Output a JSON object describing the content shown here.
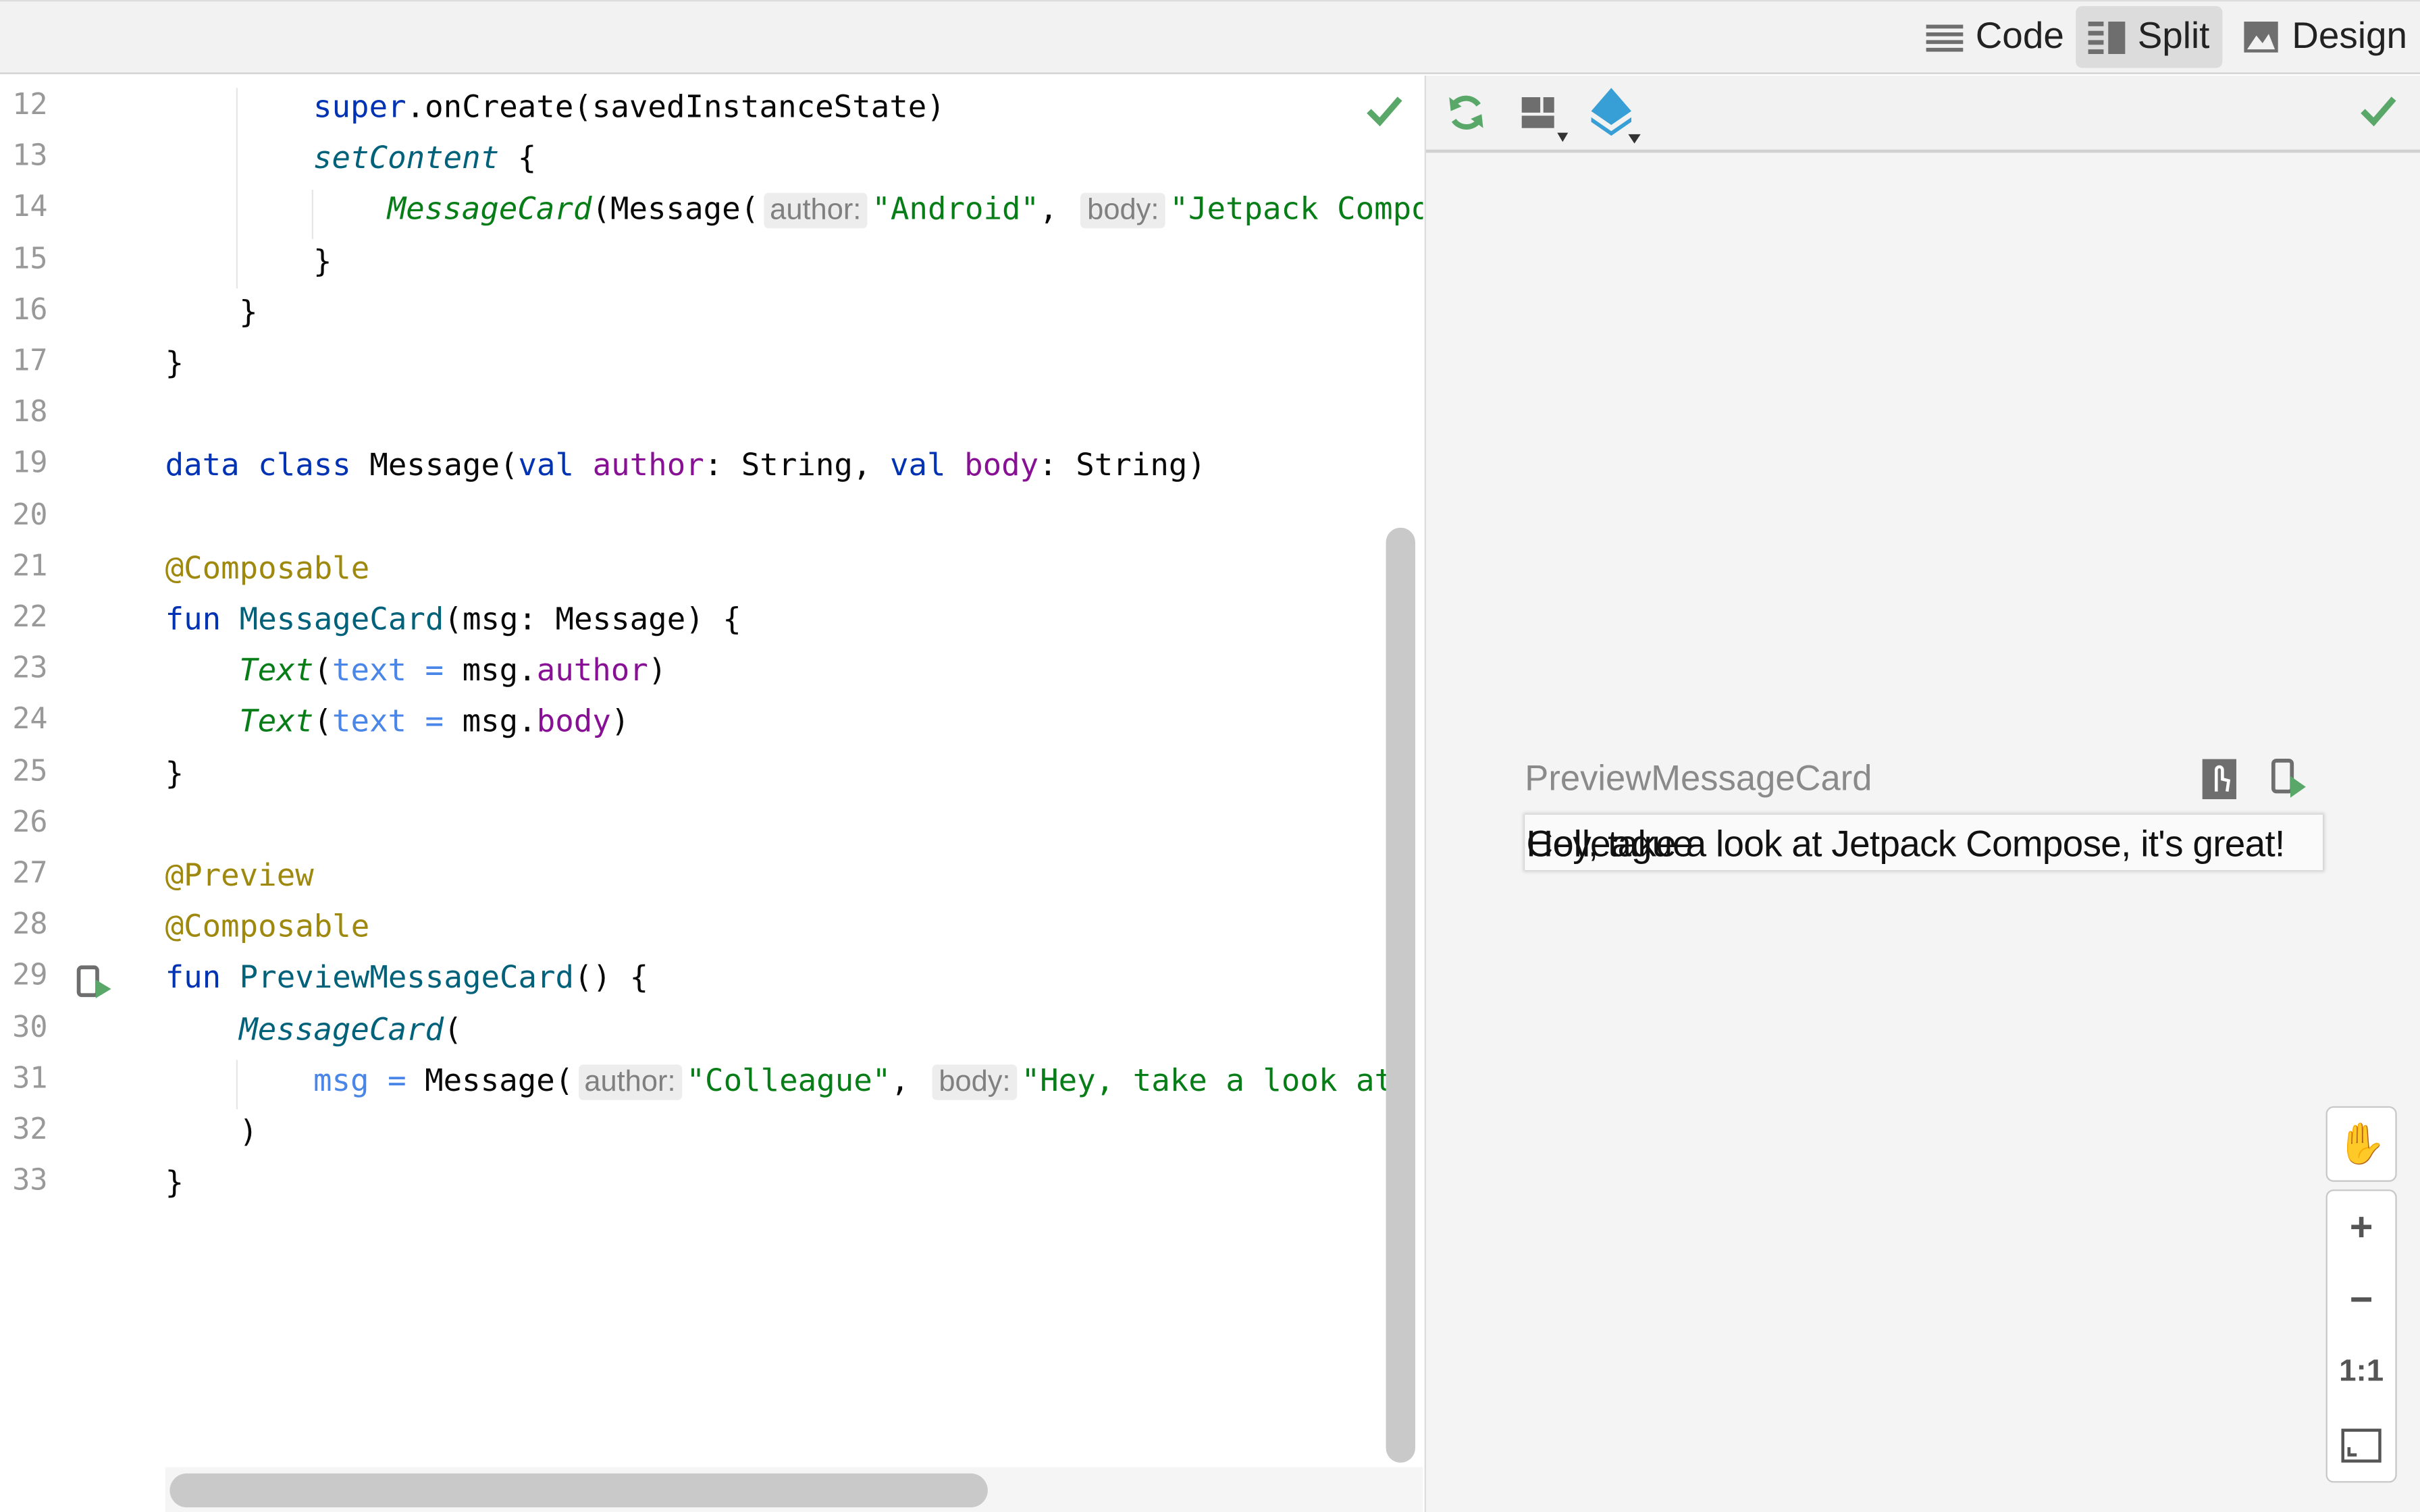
{
  "header": {
    "modes": [
      {
        "label": "Code",
        "icon": "lines-icon",
        "selected": false
      },
      {
        "label": "Split",
        "icon": "split-icon",
        "selected": true
      },
      {
        "label": "Design",
        "icon": "image-icon",
        "selected": false
      }
    ]
  },
  "editor": {
    "lines": [
      {
        "n": "12",
        "indent": 8,
        "tokens": [
          {
            "t": "super",
            "c": "kw"
          },
          {
            "t": ".onCreate(savedInstanceState)",
            "c": ""
          }
        ]
      },
      {
        "n": "13",
        "indent": 8,
        "tokens": [
          {
            "t": "setContent",
            "c": "ifn"
          },
          {
            "t": " {",
            "c": ""
          }
        ]
      },
      {
        "n": "14",
        "indent": 12,
        "tokens": [
          {
            "t": "MessageCard",
            "c": "igr"
          },
          {
            "t": "(Message(",
            "c": ""
          },
          {
            "t": "author:",
            "c": "hint"
          },
          {
            "t": "\"Android\"",
            "c": "str"
          },
          {
            "t": ", ",
            "c": ""
          },
          {
            "t": "body:",
            "c": "hint"
          },
          {
            "t": "\"Jetpack Compose\"",
            "c": "str"
          }
        ]
      },
      {
        "n": "15",
        "indent": 8,
        "tokens": [
          {
            "t": "}",
            "c": ""
          }
        ]
      },
      {
        "n": "16",
        "indent": 4,
        "tokens": [
          {
            "t": "}",
            "c": ""
          }
        ]
      },
      {
        "n": "17",
        "indent": 0,
        "tokens": [
          {
            "t": "}",
            "c": ""
          }
        ]
      },
      {
        "n": "18",
        "indent": 0,
        "tokens": []
      },
      {
        "n": "19",
        "indent": 0,
        "tokens": [
          {
            "t": "data class ",
            "c": "kw"
          },
          {
            "t": "Message(",
            "c": ""
          },
          {
            "t": "val ",
            "c": "kw"
          },
          {
            "t": "author",
            "c": "prop"
          },
          {
            "t": ": String, ",
            "c": ""
          },
          {
            "t": "val ",
            "c": "kw"
          },
          {
            "t": "body",
            "c": "prop"
          },
          {
            "t": ": String)",
            "c": ""
          }
        ]
      },
      {
        "n": "20",
        "indent": 0,
        "tokens": []
      },
      {
        "n": "21",
        "indent": 0,
        "tokens": [
          {
            "t": "@Composable",
            "c": "ann"
          }
        ]
      },
      {
        "n": "22",
        "indent": 0,
        "tokens": [
          {
            "t": "fun ",
            "c": "kw"
          },
          {
            "t": "MessageCard",
            "c": "fn"
          },
          {
            "t": "(msg: Message) {",
            "c": ""
          }
        ]
      },
      {
        "n": "23",
        "indent": 4,
        "tokens": [
          {
            "t": "Text",
            "c": "igr"
          },
          {
            "t": "(",
            "c": ""
          },
          {
            "t": "text = ",
            "c": "par"
          },
          {
            "t": "msg.",
            "c": ""
          },
          {
            "t": "author",
            "c": "prop"
          },
          {
            "t": ")",
            "c": ""
          }
        ]
      },
      {
        "n": "24",
        "indent": 4,
        "tokens": [
          {
            "t": "Text",
            "c": "igr"
          },
          {
            "t": "(",
            "c": ""
          },
          {
            "t": "text = ",
            "c": "par"
          },
          {
            "t": "msg.",
            "c": ""
          },
          {
            "t": "body",
            "c": "prop"
          },
          {
            "t": ")",
            "c": ""
          }
        ]
      },
      {
        "n": "25",
        "indent": 0,
        "tokens": [
          {
            "t": "}",
            "c": ""
          }
        ]
      },
      {
        "n": "26",
        "indent": 0,
        "tokens": []
      },
      {
        "n": "27",
        "indent": 0,
        "tokens": [
          {
            "t": "@Preview",
            "c": "ann"
          }
        ]
      },
      {
        "n": "28",
        "indent": 0,
        "tokens": [
          {
            "t": "@Composable",
            "c": "ann"
          }
        ]
      },
      {
        "n": "29",
        "indent": 0,
        "tokens": [
          {
            "t": "fun ",
            "c": "kw"
          },
          {
            "t": "PreviewMessageCard",
            "c": "fn"
          },
          {
            "t": "() {",
            "c": ""
          }
        ]
      },
      {
        "n": "30",
        "indent": 4,
        "tokens": [
          {
            "t": "MessageCard",
            "c": "ifn"
          },
          {
            "t": "(",
            "c": ""
          }
        ]
      },
      {
        "n": "31",
        "indent": 8,
        "tokens": [
          {
            "t": "msg = ",
            "c": "par"
          },
          {
            "t": "Message(",
            "c": ""
          },
          {
            "t": "author:",
            "c": "hint"
          },
          {
            "t": "\"Colleague\"",
            "c": "str"
          },
          {
            "t": ", ",
            "c": ""
          },
          {
            "t": "body:",
            "c": "hint"
          },
          {
            "t": "\"Hey, take a look at",
            "c": "str"
          }
        ]
      },
      {
        "n": "32",
        "indent": 4,
        "tokens": [
          {
            "t": ")",
            "c": ""
          }
        ]
      },
      {
        "n": "33",
        "indent": 0,
        "tokens": [
          {
            "t": "}",
            "c": ""
          }
        ]
      }
    ]
  },
  "preview": {
    "title": "PreviewMessageCard",
    "author_text": "Colleague",
    "body_text": "Hey, take a look at Jetpack Compose, it's great!",
    "zoom": {
      "actual_size": "1:1"
    }
  },
  "colors": {
    "accent_green": "#59a869",
    "accent_blue": "#389fd6"
  }
}
